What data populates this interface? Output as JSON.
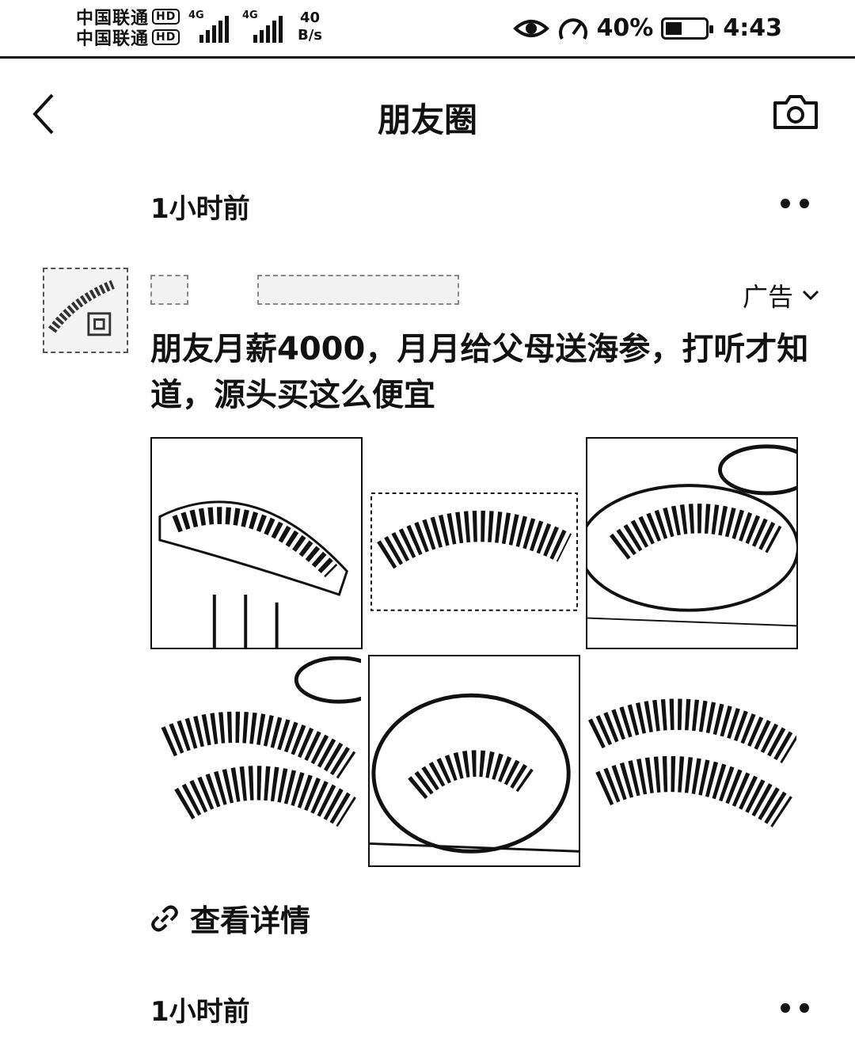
{
  "status_bar": {
    "carrier_1": "中国联通",
    "carrier_2": "中国联通",
    "hd_badge": "HD",
    "network_1": "4G",
    "network_2": "4G",
    "net_speed_value": "40",
    "net_speed_unit": "B/s",
    "battery_percent": "40%",
    "battery_level": 0.4,
    "time": "4:43"
  },
  "header": {
    "title": "朋友圈",
    "back_icon": "chevron-left-icon",
    "camera_icon": "camera-icon"
  },
  "feed": {
    "post_1": {
      "timestamp": "1小时前",
      "ad_label": "广告",
      "text": "朋友月薪4000，月月给父母送海参，打听才知道，源头买这么便宜",
      "image_count": 6,
      "detail_link": "查看详情"
    },
    "post_2": {
      "timestamp": "1小时前"
    }
  }
}
